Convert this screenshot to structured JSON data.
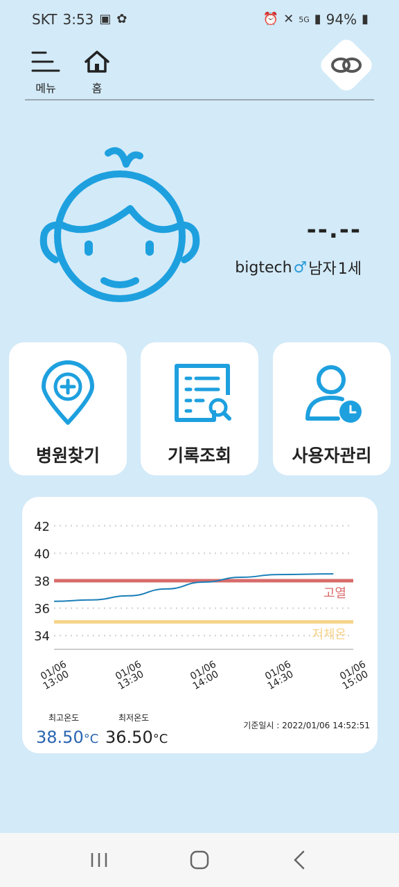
{
  "status_bar": {
    "carrier": "SKT",
    "time": "3:53",
    "network": "5G",
    "battery": "94%"
  },
  "header": {
    "menu_label": "메뉴",
    "home_label": "홈",
    "icons": [
      "menu-icon",
      "home-icon",
      "link-icon"
    ]
  },
  "profile": {
    "temperature": "--.--",
    "name": "bigtech",
    "gender_symbol": "♂",
    "gender": "남자",
    "age": "1세"
  },
  "actions": [
    {
      "label": "병원찾기",
      "icon": "map-pin-plus-icon"
    },
    {
      "label": "기록조회",
      "icon": "record-search-icon"
    },
    {
      "label": "사용자관리",
      "icon": "user-clock-icon"
    }
  ],
  "chart_data": {
    "type": "line",
    "y_ticks": [
      "42",
      "40",
      "38",
      "36",
      "34"
    ],
    "ylim": [
      33,
      43
    ],
    "x_ticks": [
      {
        "date": "01/06",
        "time": "13:00"
      },
      {
        "date": "01/06",
        "time": "13:30"
      },
      {
        "date": "01/06",
        "time": "14:00"
      },
      {
        "date": "01/06",
        "time": "14:30"
      },
      {
        "date": "01/06",
        "time": "15:00"
      }
    ],
    "series": [
      {
        "x": [
          "13:00",
          "13:15",
          "13:30",
          "13:45",
          "14:00",
          "14:15",
          "14:30",
          "14:52"
        ],
        "values": [
          36.5,
          36.6,
          36.9,
          37.4,
          37.9,
          38.25,
          38.45,
          38.5
        ],
        "color": "#1b7fb8"
      }
    ],
    "thresholds": [
      {
        "label": "고열",
        "value": 38,
        "color": "#d96b6b"
      },
      {
        "label": "저체온",
        "value": 35,
        "color": "#f6d38a"
      }
    ],
    "grid": true
  },
  "stats": {
    "max_label": "최고온도",
    "max_value": "38.50",
    "min_label": "최저온도",
    "min_value": "36.50",
    "unit": "°C",
    "ref_time": "기준일시  : 2022/01/06 14:52:51"
  }
}
